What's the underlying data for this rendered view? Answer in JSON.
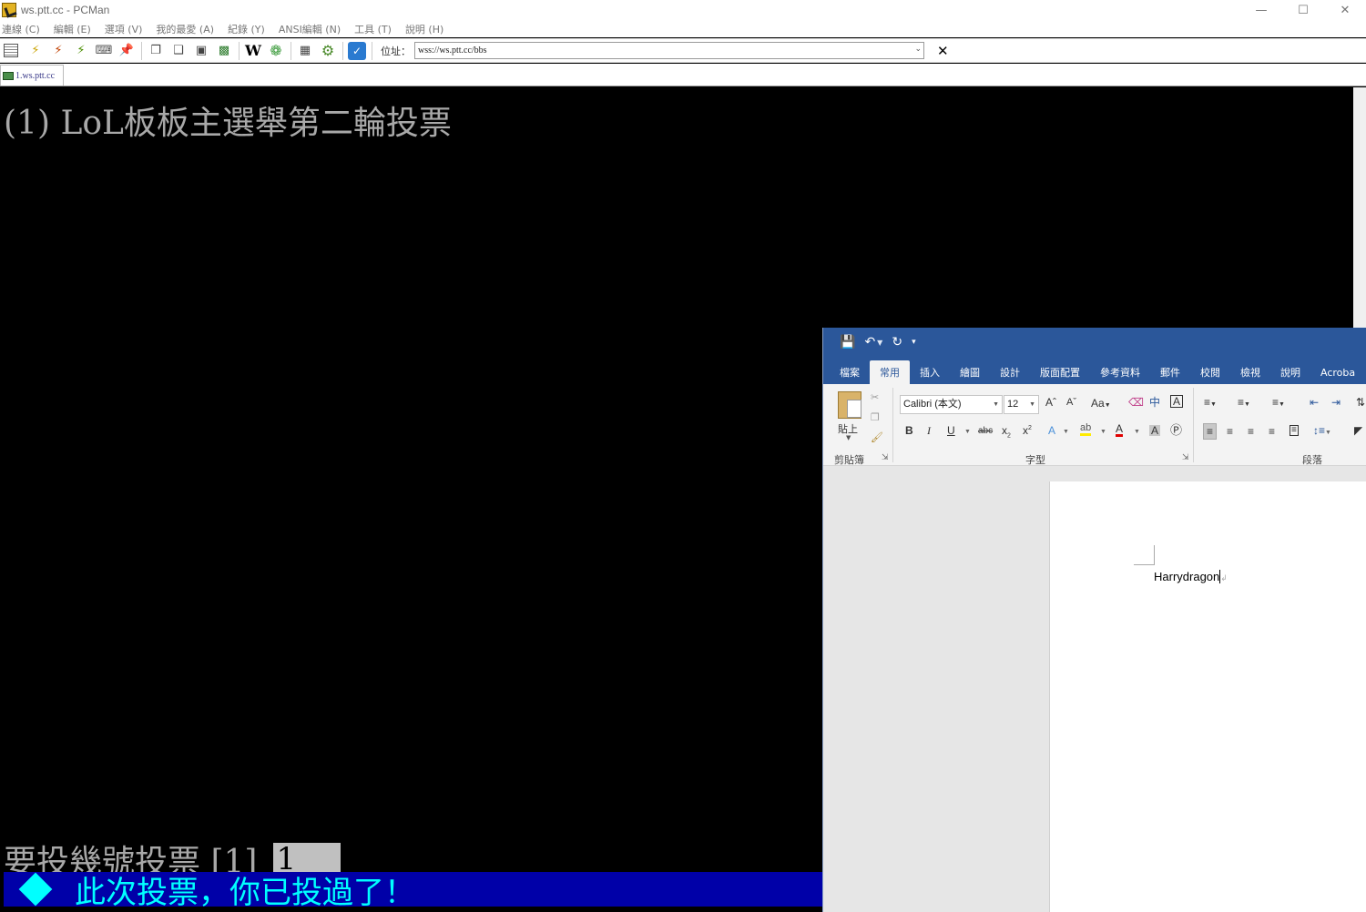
{
  "pcman": {
    "title": "ws.ptt.cc - PCMan",
    "menu": [
      "連線 (C)",
      "編輯 (E)",
      "選項 (V)",
      "我的最愛 (A)",
      "紀錄 (Y)",
      "ANSI編輯 (N)",
      "工具 (T)",
      "說明 (H)"
    ],
    "address_label": "位址：",
    "address_value": "wss://ws.ptt.cc/bbs",
    "tab_label": "1.ws.ptt.cc",
    "terminal": {
      "title_line": "(1) LoL板板主選舉第二輪投票",
      "prompt": "要投幾號投票 [1]",
      "input_value": "1",
      "status_line": "此次投票，你已投過了！"
    },
    "colors": {
      "terminal_text": "#a8a8a8",
      "status_bg": "#0000a8",
      "status_text": "#00ffff"
    }
  },
  "word": {
    "tabs": [
      "檔案",
      "常用",
      "插入",
      "繪圖",
      "設計",
      "版面配置",
      "參考資料",
      "郵件",
      "校閱",
      "檢視",
      "說明",
      "Acroba"
    ],
    "active_tab": "常用",
    "groups": {
      "clipboard": "剪貼簿",
      "font": "字型",
      "paragraph": "段落"
    },
    "paste_label": "貼上",
    "font_name": "Calibri (本文)",
    "font_size": "12",
    "document_text": "Harrydragon",
    "colors": {
      "ribbon_blue": "#2b579a"
    }
  }
}
